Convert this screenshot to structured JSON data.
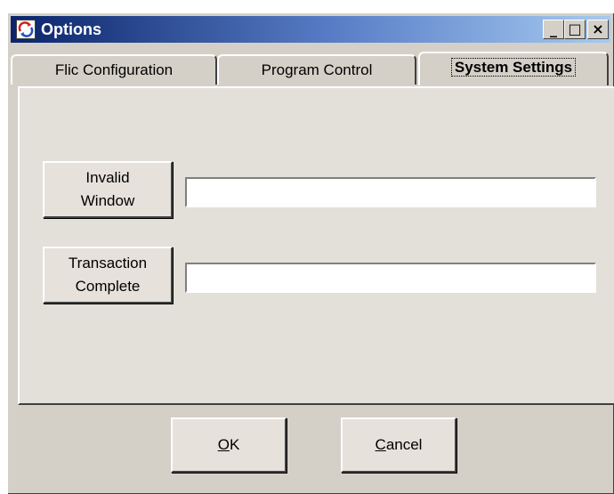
{
  "window": {
    "title": "Options",
    "controls": {
      "minimize": "_",
      "maximize": "□",
      "close": "×"
    }
  },
  "tabs": [
    {
      "label": "Flic Configuration",
      "active": false
    },
    {
      "label": "Program Control",
      "active": false
    },
    {
      "label": "System Settings",
      "active": true
    }
  ],
  "settings": {
    "invalid_window": {
      "button_label": "Invalid\nWindow",
      "value": ""
    },
    "transaction_complete": {
      "button_label": "Transaction\nComplete",
      "value": ""
    }
  },
  "footer": {
    "ok_mnemonic": "O",
    "ok_rest": "K",
    "cancel_mnemonic": "C",
    "cancel_rest": "ancel"
  },
  "icons": {
    "app": "options-app-icon"
  },
  "colors": {
    "face": "#d4d0c8",
    "title_start": "#0a246a",
    "title_end": "#a6caf0"
  }
}
